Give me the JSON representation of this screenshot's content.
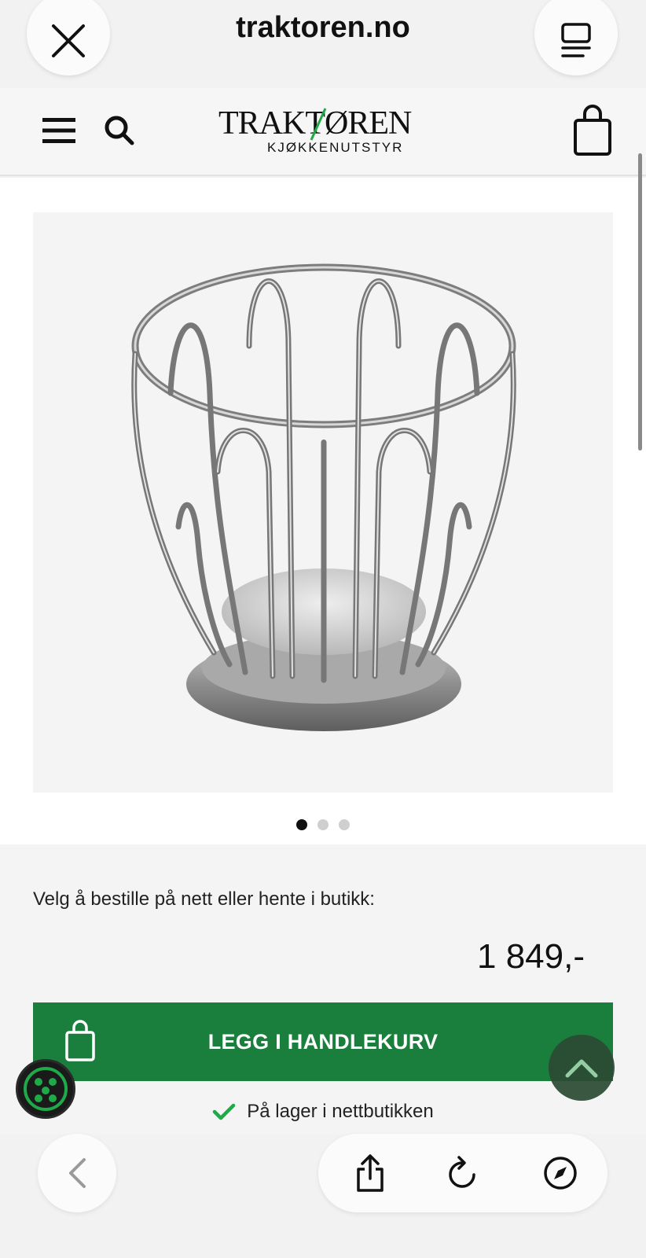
{
  "browser": {
    "url": "traktoren.no",
    "close_icon": "close-icon",
    "tabs_icon": "tabs-icon",
    "back_icon": "chevron-left-icon",
    "share_icon": "share-icon",
    "reload_icon": "reload-icon",
    "compass_icon": "compass-icon"
  },
  "header": {
    "logo_main": "TRAKTØREN",
    "logo_sub": "KJØKKENUTSTYR",
    "menu_icon": "hamburger-menu-icon",
    "search_icon": "search-icon",
    "cart_icon": "shopping-bag-icon"
  },
  "product": {
    "image_alt": "wire fruit basket",
    "gallery_count": 3,
    "gallery_active": 1
  },
  "purchase": {
    "order_prompt": "Velg å bestille på nett eller hente i butikk:",
    "price": "1 849,-",
    "add_to_cart_label": "LEGG I HANDLEKURV",
    "stock_status": "På lager i nettbutikken"
  },
  "colors": {
    "accent_green": "#1a7f3c",
    "check_green": "#1faa4a",
    "scroll_top_bg": "#2b4a33"
  }
}
